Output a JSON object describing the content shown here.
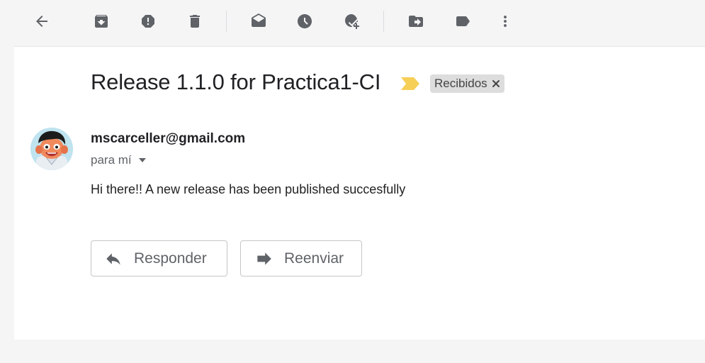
{
  "toolbar": {
    "buttons": [
      {
        "icon": "arrow-back-icon",
        "label": "Back"
      },
      {
        "icon": "archive-icon",
        "label": "Archive"
      },
      {
        "icon": "report-spam-icon",
        "label": "Report spam"
      },
      {
        "icon": "delete-icon",
        "label": "Delete"
      },
      {
        "icon": "mark-unread-icon",
        "label": "Mark as unread"
      },
      {
        "icon": "snooze-icon",
        "label": "Snooze"
      },
      {
        "icon": "add-to-tasks-icon",
        "label": "Add to tasks"
      },
      {
        "icon": "move-to-icon",
        "label": "Move to"
      },
      {
        "icon": "label-icon",
        "label": "Labels"
      },
      {
        "icon": "more-vert-icon",
        "label": "More"
      }
    ]
  },
  "email": {
    "subject": "Release 1.1.0 for Practica1-CI",
    "label": "Recibidos",
    "sender": "mscarceller@gmail.com",
    "recipient": "para mí",
    "body": "Hi there!! A new release has been published succesfully"
  },
  "actions": {
    "reply_label": "Responder",
    "forward_label": "Reenviar"
  },
  "colors": {
    "importance_marker": "#f6cf57",
    "icon_gray": "#5f6368",
    "background": "#f5f5f5"
  }
}
